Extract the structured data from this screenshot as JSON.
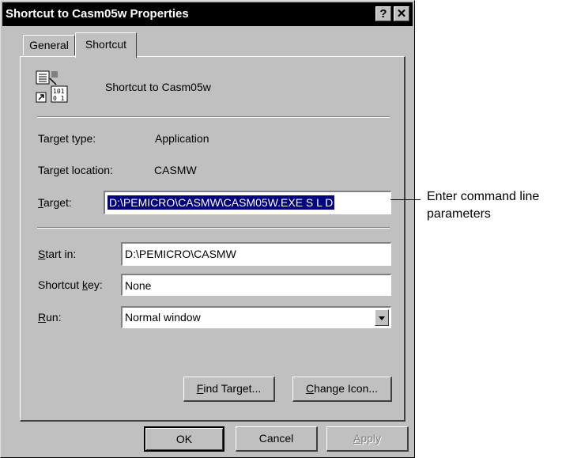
{
  "window": {
    "title": "Shortcut to Casm05w Properties",
    "help_glyph": "?",
    "close_glyph": "✕"
  },
  "tabs": [
    {
      "label": "General",
      "active": false
    },
    {
      "label": "Shortcut",
      "active": true
    }
  ],
  "shortcut": {
    "icon": "shortcut-application-icon",
    "name": "Shortcut to Casm05w",
    "target_type_label": "Target type:",
    "target_type_value": "Application",
    "target_location_label": "Target location:",
    "target_location_value": "CASMW",
    "target_label_key": "T",
    "target_label_rest": "arget:",
    "target_value": "D:\\PEMICRO\\CASMW\\CASM05W.EXE S L D",
    "start_in_label_key": "S",
    "start_in_label_rest": "tart in:",
    "start_in_value": "D:\\PEMICRO\\CASMW",
    "shortcut_key_label_pre": "Shortcut ",
    "shortcut_key_label_key": "k",
    "shortcut_key_label_post": "ey:",
    "shortcut_key_value": "None",
    "run_label_key": "R",
    "run_label_rest": "un:",
    "run_value": "Normal window"
  },
  "buttons": {
    "find_target_key": "F",
    "find_target_rest": "ind Target...",
    "change_icon_key": "C",
    "change_icon_rest": "hange Icon...",
    "ok": "OK",
    "cancel": "Cancel",
    "apply_key": "A",
    "apply_rest": "pply"
  },
  "annotation": {
    "line1": "Enter command line",
    "line2": "parameters"
  }
}
